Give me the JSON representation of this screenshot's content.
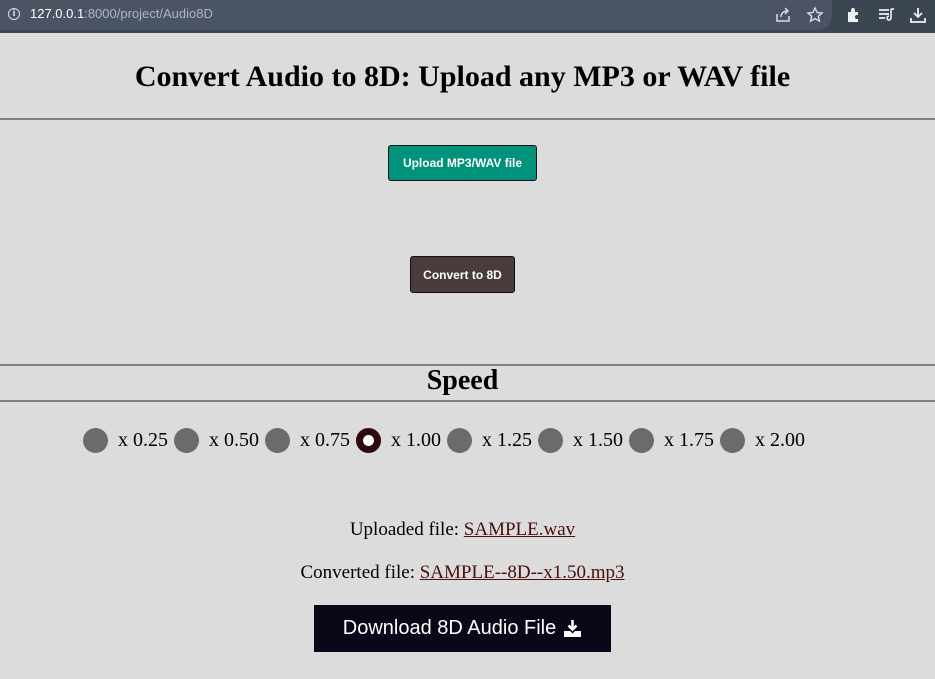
{
  "browser": {
    "url_host": "127.0.0.1",
    "url_rest": ":8000/project/Audio8D",
    "icons": [
      "info-icon",
      "share-icon",
      "star-icon",
      "extensions-icon",
      "reading-list-icon",
      "download-icon"
    ]
  },
  "page": {
    "title": "Convert Audio to 8D: Upload any MP3 or WAV file",
    "upload_button": "Upload MP3/WAV file",
    "convert_button": "Convert to 8D",
    "speed_title": "Speed",
    "speed_options": [
      "x 0.25",
      "x 0.50",
      "x 0.75",
      "x 1.00",
      "x 1.25",
      "x 1.50",
      "x 1.75",
      "x 2.00"
    ],
    "selected_speed": "x 1.00",
    "uploaded_label": "Uploaded file: ",
    "uploaded_file": "SAMPLE.wav",
    "converted_label": "Converted file: ",
    "converted_file": "SAMPLE--8D--x1.50.mp3",
    "download_button": "Download 8D Audio File"
  },
  "colors": {
    "upload_button": "#00927a",
    "convert_button": "#4a3c3c",
    "download_button": "#080818",
    "page_background": "#dcdcdc"
  }
}
